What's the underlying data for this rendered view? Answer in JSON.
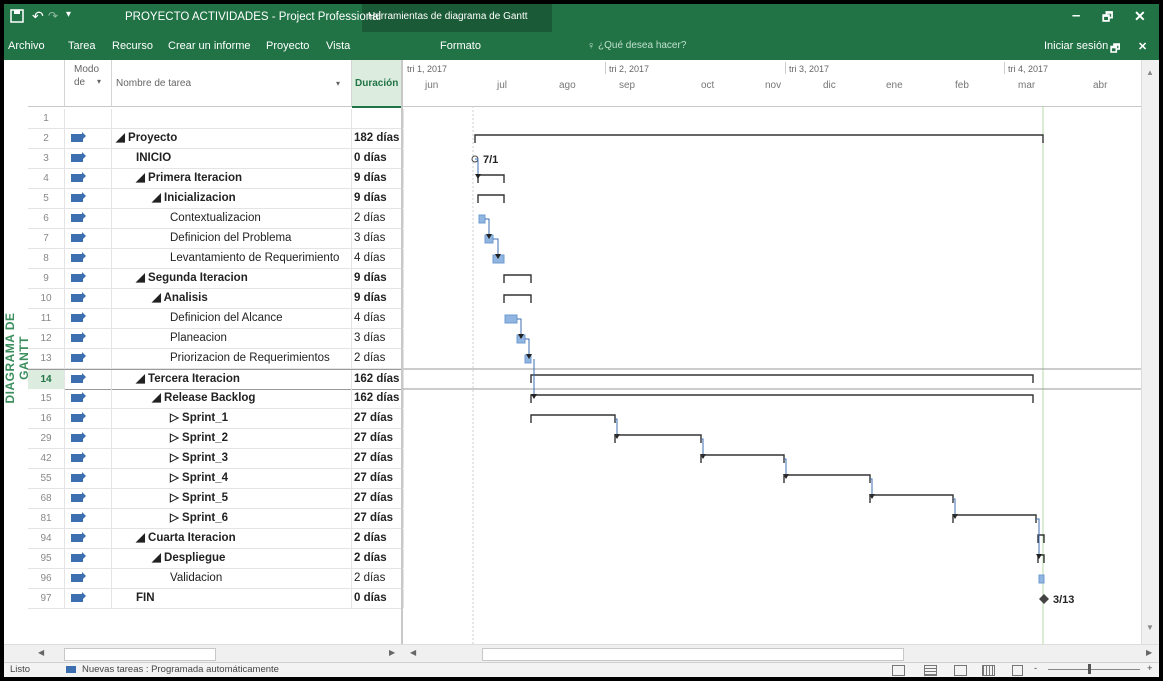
{
  "app": {
    "title": "PROYECTO ACTIVIDADES - Project Professional",
    "context_tab": "Herramientas de diagrama de Gantt",
    "sign_in": "Iniciar sesión",
    "minimize": "–",
    "restore": "🗗",
    "close": "✕"
  },
  "quick_access": {
    "save_icon": "save-icon",
    "undo_icon": "undo-icon",
    "redo_icon": "redo-icon"
  },
  "menu": {
    "items": [
      "Archivo",
      "Tarea",
      "Recurso",
      "Crear un informe",
      "Proyecto",
      "Vista"
    ],
    "format": "Formato",
    "tell_me": "¿Qué desea hacer?"
  },
  "side_label": "DIAGRAMA DE GANTT",
  "columns": {
    "mode_line1": "Modo",
    "mode_line2": "de",
    "name": "Nombre de tarea",
    "duration": "Duración"
  },
  "tasks": [
    {
      "id": "1",
      "indent": 0,
      "name": "",
      "duration": "",
      "bold": false
    },
    {
      "id": "2",
      "indent": 0,
      "name": "◢ Proyecto",
      "duration": "182 días",
      "bold": true
    },
    {
      "id": "3",
      "indent": 1,
      "name": "INICIO",
      "duration": "0 días",
      "bold": true
    },
    {
      "id": "4",
      "indent": 1,
      "name": "◢ Primera Iteracion",
      "duration": "9 días",
      "bold": true
    },
    {
      "id": "5",
      "indent": 2,
      "name": "◢ Inicializacion",
      "duration": "9 días",
      "bold": true
    },
    {
      "id": "6",
      "indent": 3,
      "name": "Contextualizacion",
      "duration": "2 días",
      "bold": false
    },
    {
      "id": "7",
      "indent": 3,
      "name": "Definicion del Problema",
      "duration": "3 días",
      "bold": false
    },
    {
      "id": "8",
      "indent": 3,
      "name": "Levantamiento de Requerimiento",
      "duration": "4 días",
      "bold": false
    },
    {
      "id": "9",
      "indent": 1,
      "name": "◢ Segunda Iteracion",
      "duration": "9 días",
      "bold": true
    },
    {
      "id": "10",
      "indent": 2,
      "name": "◢ Analisis",
      "duration": "9 días",
      "bold": true
    },
    {
      "id": "11",
      "indent": 3,
      "name": "Definicion del Alcance",
      "duration": "4 días",
      "bold": false
    },
    {
      "id": "12",
      "indent": 3,
      "name": "Planeacion",
      "duration": "3 días",
      "bold": false
    },
    {
      "id": "13",
      "indent": 3,
      "name": "Priorizacion de Requerimientos",
      "duration": "2 días",
      "bold": false
    },
    {
      "id": "14",
      "indent": 1,
      "name": "◢ Tercera Iteracion",
      "duration": "162 días",
      "bold": true
    },
    {
      "id": "15",
      "indent": 2,
      "name": "◢ Release Backlog",
      "duration": "162 días",
      "bold": true
    },
    {
      "id": "16",
      "indent": 3,
      "name": "▷ Sprint_1",
      "duration": "27 días",
      "bold": true
    },
    {
      "id": "29",
      "indent": 3,
      "name": "▷ Sprint_2",
      "duration": "27 días",
      "bold": true
    },
    {
      "id": "42",
      "indent": 3,
      "name": "▷ Sprint_3",
      "duration": "27 días",
      "bold": true
    },
    {
      "id": "55",
      "indent": 3,
      "name": "▷ Sprint_4",
      "duration": "27 días",
      "bold": true
    },
    {
      "id": "68",
      "indent": 3,
      "name": "▷ Sprint_5",
      "duration": "27 días",
      "bold": true
    },
    {
      "id": "81",
      "indent": 3,
      "name": "▷ Sprint_6",
      "duration": "27 días",
      "bold": true
    },
    {
      "id": "94",
      "indent": 1,
      "name": "◢ Cuarta Iteracion",
      "duration": "2 días",
      "bold": true
    },
    {
      "id": "95",
      "indent": 2,
      "name": "◢ Despliegue",
      "duration": "2 días",
      "bold": true
    },
    {
      "id": "96",
      "indent": 3,
      "name": "Validacion",
      "duration": "2 días",
      "bold": false
    },
    {
      "id": "97",
      "indent": 1,
      "name": "FIN",
      "duration": "0 días",
      "bold": true
    }
  ],
  "selected_task_id": "14",
  "timeline": {
    "quarters": [
      "tri 1, 2017",
      "tri 2, 2017",
      "tri 3, 2017",
      "tri 4, 2017"
    ],
    "months": [
      "jun",
      "jul",
      "ago",
      "sep",
      "oct",
      "nov",
      "dic",
      "ene",
      "feb",
      "mar",
      "abr"
    ]
  },
  "milestones": {
    "start_label": "7/1",
    "end_label": "3/13"
  },
  "status": {
    "ready": "Listo",
    "new_tasks": "Nuevas tareas : Programada automáticamente",
    "zoom_minus": "-",
    "zoom_plus": "+"
  }
}
